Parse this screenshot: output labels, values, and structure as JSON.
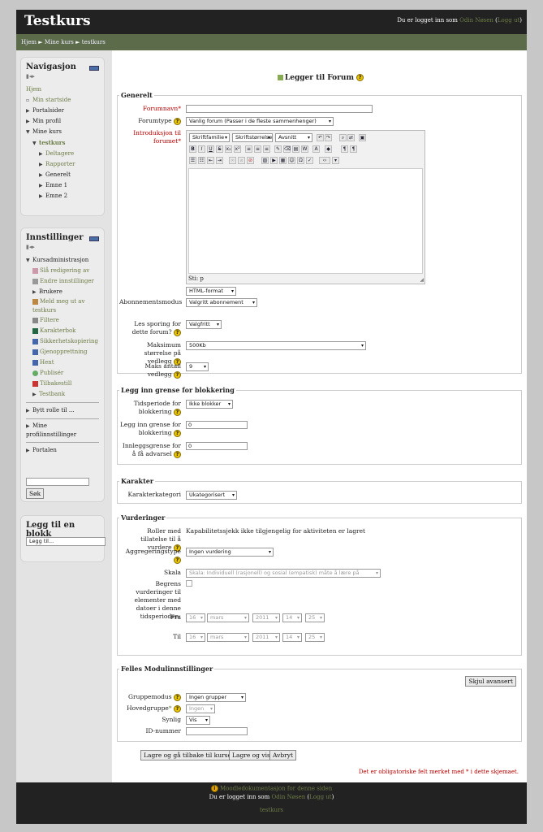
{
  "site": {
    "title": "Testkurs"
  },
  "header": {
    "login_prefix": "Du er logget inn som",
    "user": "Odin Nøsen",
    "logout": "Logg ut"
  },
  "breadcrumb": {
    "items": [
      "Hjem",
      "Mine kurs",
      "testkurs"
    ],
    "sep": "►"
  },
  "nav_block": {
    "title": "Navigasjon",
    "items": {
      "home": "Hjem",
      "start": "Min startside",
      "portal": "Portalsider",
      "profile": "Min profil",
      "courses": "Mine kurs",
      "course": "testkurs",
      "participants": "Deltagere",
      "reports": "Rapporter",
      "general": "Generelt",
      "topic1": "Emne 1",
      "topic2": "Emne 2"
    }
  },
  "settings_block": {
    "title": "Innstillinger",
    "items": {
      "admin": "Kursadministrasjon",
      "editing": "Slå redigering av",
      "edit_settings": "Endre innstillinger",
      "users": "Brukere",
      "unenrol": "Meld meg ut av testkurs",
      "filters": "Filtere",
      "gradebook": "Karakterbok",
      "backup": "Sikkerhetskopiering",
      "restore": "Gjenopprettning",
      "import": "Hent",
      "publish": "Publisér",
      "reset": "Tilbakestill",
      "qbank": "Testbank",
      "switchrole": "Bytt rolle til ...",
      "profile_settings": "Mine profilinnstillinger",
      "siteadmin": "Portalen"
    },
    "search_button": "Søk"
  },
  "addblock": {
    "title": "Legg til en blokk",
    "select": "Legg til..."
  },
  "page_title": "Legger til Forum",
  "sections": {
    "general": {
      "legend": "Generelt",
      "name_label": "Forumnavn",
      "type_label": "Forumtype",
      "type_value": "Vanlig forum (Passer i de fleste sammenhenger)",
      "intro_label": "Introduksjon til forumet",
      "font_family": "Skriftfamilie",
      "font_size": "Skriftstørrelse",
      "format_block": "Avsnitt",
      "path": "Sti: p",
      "format": "HTML-format",
      "subscribe_label": "Abonnementsmodus",
      "subscribe_value": "Valgritt abonnement",
      "tracking_label": "Les sporing for dette forum?",
      "tracking_value": "Valgfritt",
      "maxsize_label": "Maksimum størrelse på vedlegg",
      "maxsize_value": "500Kb",
      "maxattach_label": "Maks antall vedlegg",
      "maxattach_value": "9"
    },
    "blocking": {
      "legend": "Legg inn grense for blokkering",
      "period_label": "Tidsperiode for blokkering",
      "period_value": "Ikke blokker",
      "threshold_label": "Legg inn grense for blokkering",
      "threshold_value": "0",
      "warn_label": "Innleggsgrense for å få advarsel",
      "warn_value": "0"
    },
    "grade": {
      "legend": "Karakter",
      "cat_label": "Karakterkategori",
      "cat_value": "Ukategorisert"
    },
    "ratings": {
      "legend": "Vurderinger",
      "roles_label": "Roller med tillatelse til å vurdere",
      "roles_value": "Kapabilitetssjekk ikke tilgjengelig for aktiviteten er lagret",
      "agg_label": "Aggregeringstype",
      "agg_value": "Ingen vurdering",
      "scale_label": "Skala",
      "scale_value": "Skala: Individuell (rasjonell) og sosial (empatisk) måte å lære på",
      "restrict_label": "Begrens vurderinger til elementer med datoer i denne tidsperioden:",
      "from_label": "Fra",
      "to_label": "Til",
      "day": "16",
      "month": "mars",
      "year": "2011",
      "hour": "14",
      "minute": "25"
    },
    "common": {
      "legend": "Felles Modulinnstillinger",
      "advanced_button": "Skjul avansert",
      "group_label": "Gruppemodus",
      "group_value": "Ingen grupper",
      "grouping_label": "Hovedgruppe",
      "grouping_value": "Ingen",
      "visible_label": "Synlig",
      "visible_value": "Vis",
      "idnumber_label": "ID-nummer"
    }
  },
  "buttons": {
    "save_return": "Lagre og gå tilbake til kurset",
    "save_display": "Lagre og vis",
    "cancel": "Avbryt"
  },
  "required_note": "Det er obligatoriske felt merket med * i dette skjemaet.",
  "footer": {
    "doc_link": "Moodledokumentasjon for denne siden",
    "login_prefix": "Du er logget inn som",
    "user": "Odin Nøsen",
    "logout": "Logg ut",
    "course": "testkurs"
  }
}
